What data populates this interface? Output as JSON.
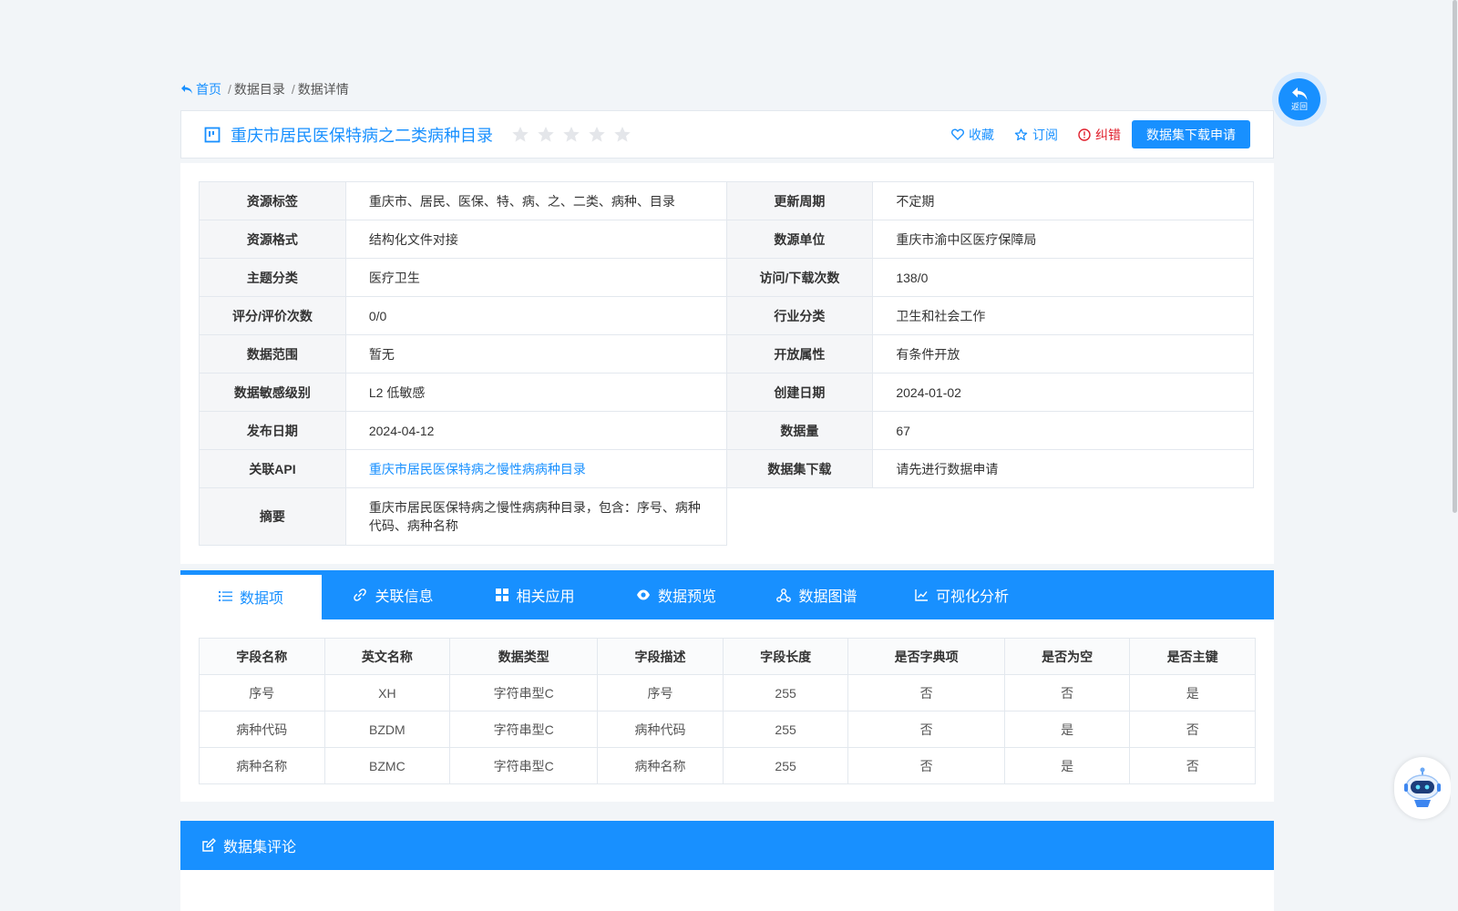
{
  "breadcrumb": {
    "home": "首页",
    "sep": "/",
    "catalog": "数据目录",
    "detail": "数据详情"
  },
  "title_bar": {
    "title": "重庆市居民医保特病之二类病种目录",
    "rating_stars": 0,
    "rating_max": 5,
    "favorite": "收藏",
    "subscribe": "订阅",
    "report": "纠错",
    "download_apply": "数据集下载申请"
  },
  "info": {
    "rows": [
      {
        "k1": "资源标签",
        "v1": "重庆市、居民、医保、特、病、之、二类、病种、目录",
        "k2": "更新周期",
        "v2": "不定期"
      },
      {
        "k1": "资源格式",
        "v1": "结构化文件对接",
        "k2": "数源单位",
        "v2": "重庆市渝中区医疗保障局"
      },
      {
        "k1": "主题分类",
        "v1": "医疗卫生",
        "k2": "访问/下载次数",
        "v2": "138/0"
      },
      {
        "k1": "评分/评价次数",
        "v1": "0/0",
        "k2": "行业分类",
        "v2": "卫生和社会工作"
      },
      {
        "k1": "数据范围",
        "v1": "暂无",
        "k2": "开放属性",
        "v2": "有条件开放"
      },
      {
        "k1": "数据敏感级别",
        "v1": "L2 低敏感",
        "k2": "创建日期",
        "v2": "2024-01-02"
      },
      {
        "k1": "发布日期",
        "v1": "2024-04-12",
        "k2": "数据量",
        "v2": "67"
      },
      {
        "k1": "关联API",
        "v1": "重庆市居民医保特病之慢性病病种目录",
        "k2": "数据集下载",
        "v2": "请先进行数据申请"
      }
    ],
    "summary_label": "摘要",
    "summary_value": "重庆市居民医保特病之慢性病病种目录，包含：序号、病种代码、病种名称"
  },
  "tabs": [
    "数据项",
    "关联信息",
    "相关应用",
    "数据预览",
    "数据图谱",
    "可视化分析"
  ],
  "fields": {
    "headers": [
      "字段名称",
      "英文名称",
      "数据类型",
      "字段描述",
      "字段长度",
      "是否字典项",
      "是否为空",
      "是否主键"
    ],
    "rows": [
      [
        "序号",
        "XH",
        "字符串型C",
        "序号",
        "255",
        "否",
        "否",
        "是"
      ],
      [
        "病种代码",
        "BZDM",
        "字符串型C",
        "病种代码",
        "255",
        "否",
        "是",
        "否"
      ],
      [
        "病种名称",
        "BZMC",
        "字符串型C",
        "病种名称",
        "255",
        "否",
        "是",
        "否"
      ]
    ]
  },
  "comments": {
    "title": "数据集评论"
  },
  "float": {
    "back": "返回"
  },
  "colors": {
    "primary": "#1890ff",
    "error": "#e0202d",
    "background": "#f2f5f8"
  }
}
